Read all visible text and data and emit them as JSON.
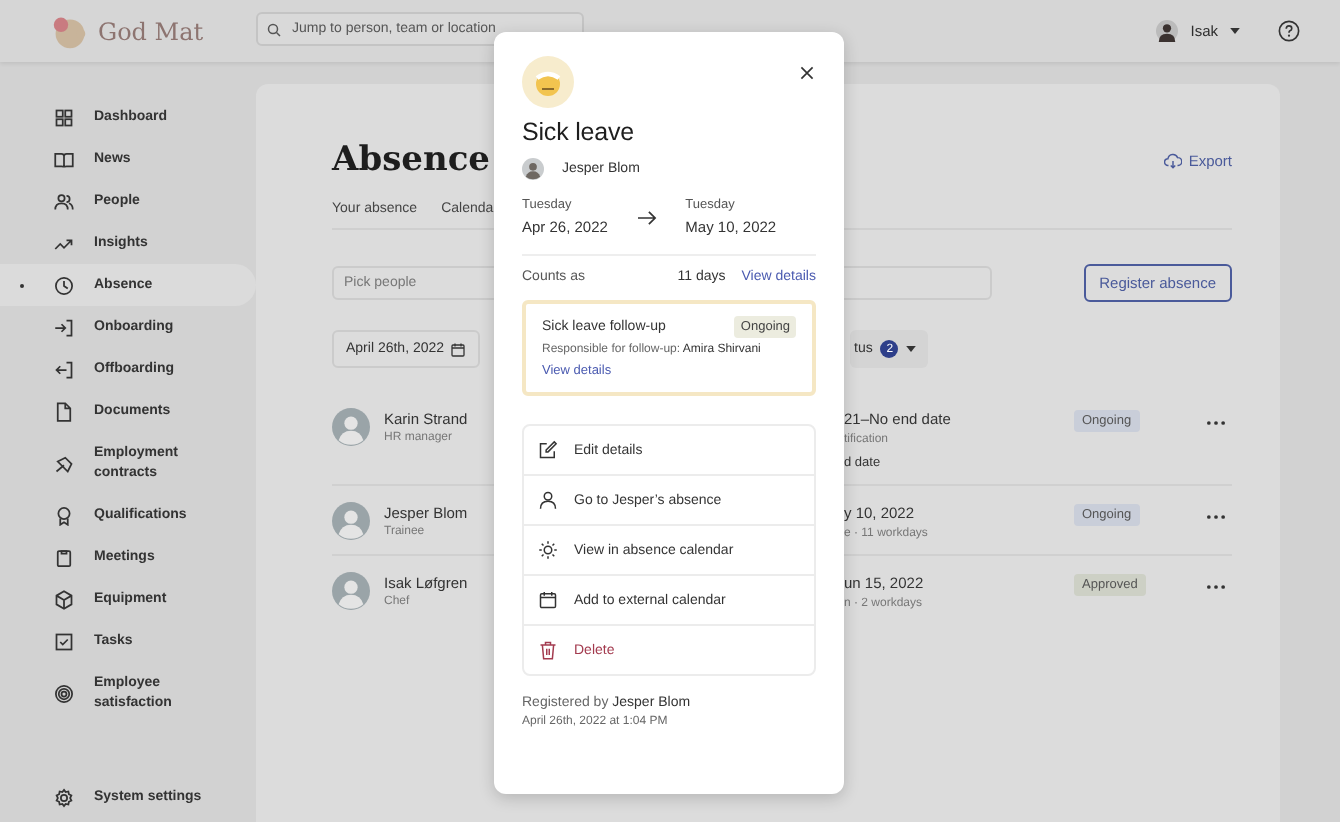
{
  "app": {
    "logo": "God Mat",
    "search": {
      "placeholder": "Jump to person, team or location"
    },
    "user": {
      "name": "Isak"
    }
  },
  "sidebar": {
    "items": [
      {
        "label": "Dashboard",
        "selected": false
      },
      {
        "label": "News",
        "selected": false
      },
      {
        "label": "People",
        "selected": false
      },
      {
        "label": "Insights",
        "selected": false
      },
      {
        "label": "Absence",
        "selected": true
      },
      {
        "label": "Onboarding",
        "selected": false
      },
      {
        "label": "Offboarding",
        "selected": false
      },
      {
        "label": "Documents",
        "selected": false
      },
      {
        "label": "Employment contracts",
        "selected": false
      },
      {
        "label": "Qualifications",
        "selected": false
      },
      {
        "label": "Meetings",
        "selected": false
      },
      {
        "label": "Equipment",
        "selected": false
      },
      {
        "label": "Tasks",
        "selected": false
      },
      {
        "label": "Employee satisfaction",
        "selected": false
      }
    ],
    "settings": "System settings"
  },
  "page": {
    "title": "Absence",
    "export": "Export",
    "tabs": [
      "Your absence",
      "Calenda"
    ],
    "people_field": {
      "placeholder": "Pick people"
    },
    "register_button": "Register absence",
    "date_filter": "April 26th, 2022",
    "status_filter": {
      "label": "tus",
      "count": "2"
    },
    "rows": [
      {
        "name": "Karin Strand",
        "role": "HR manager",
        "dates": "21–No end date",
        "detail": "tification",
        "extra": "d date",
        "status": "Ongoing",
        "color": "#c9ced9"
      },
      {
        "name": "Jesper Blom",
        "role": "Trainee",
        "dates": "y 10, 2022",
        "detail": "e · 11 workdays",
        "status": "Ongoing",
        "color": "#c9ced9"
      },
      {
        "name": "Isak Løfgren",
        "role": "Chef",
        "dates": "un 15, 2022",
        "detail": "n · 2 workdays",
        "status": "Approved",
        "color": "#cdd0c5"
      }
    ]
  },
  "modal": {
    "title": "Sick leave",
    "person": "Jesper Blom",
    "start": {
      "day": "Tuesday",
      "date": "Apr 26, 2022"
    },
    "end": {
      "day": "Tuesday",
      "date": "May 10, 2022"
    },
    "counts_label": "Counts as",
    "counts_value": "11 days",
    "counts_link": "View details",
    "followup": {
      "title": "Sick leave follow-up",
      "status": "Ongoing",
      "responsible": "Responsible for follow-up: **Amira Shirvani**",
      "link": "View details"
    },
    "actions": [
      {
        "label": "Edit details",
        "kind": "edit"
      },
      {
        "label": "Go to Jesper’s absence",
        "kind": "person"
      },
      {
        "label": "View in absence calendar",
        "kind": "sun"
      },
      {
        "label": "Add to external calendar",
        "kind": "calendar"
      },
      {
        "label": "Delete",
        "kind": "delete"
      }
    ],
    "registered": "Registered by **Jesper Blom**",
    "registered_at": "April 26th, 2022 at 1:04 PM"
  }
}
